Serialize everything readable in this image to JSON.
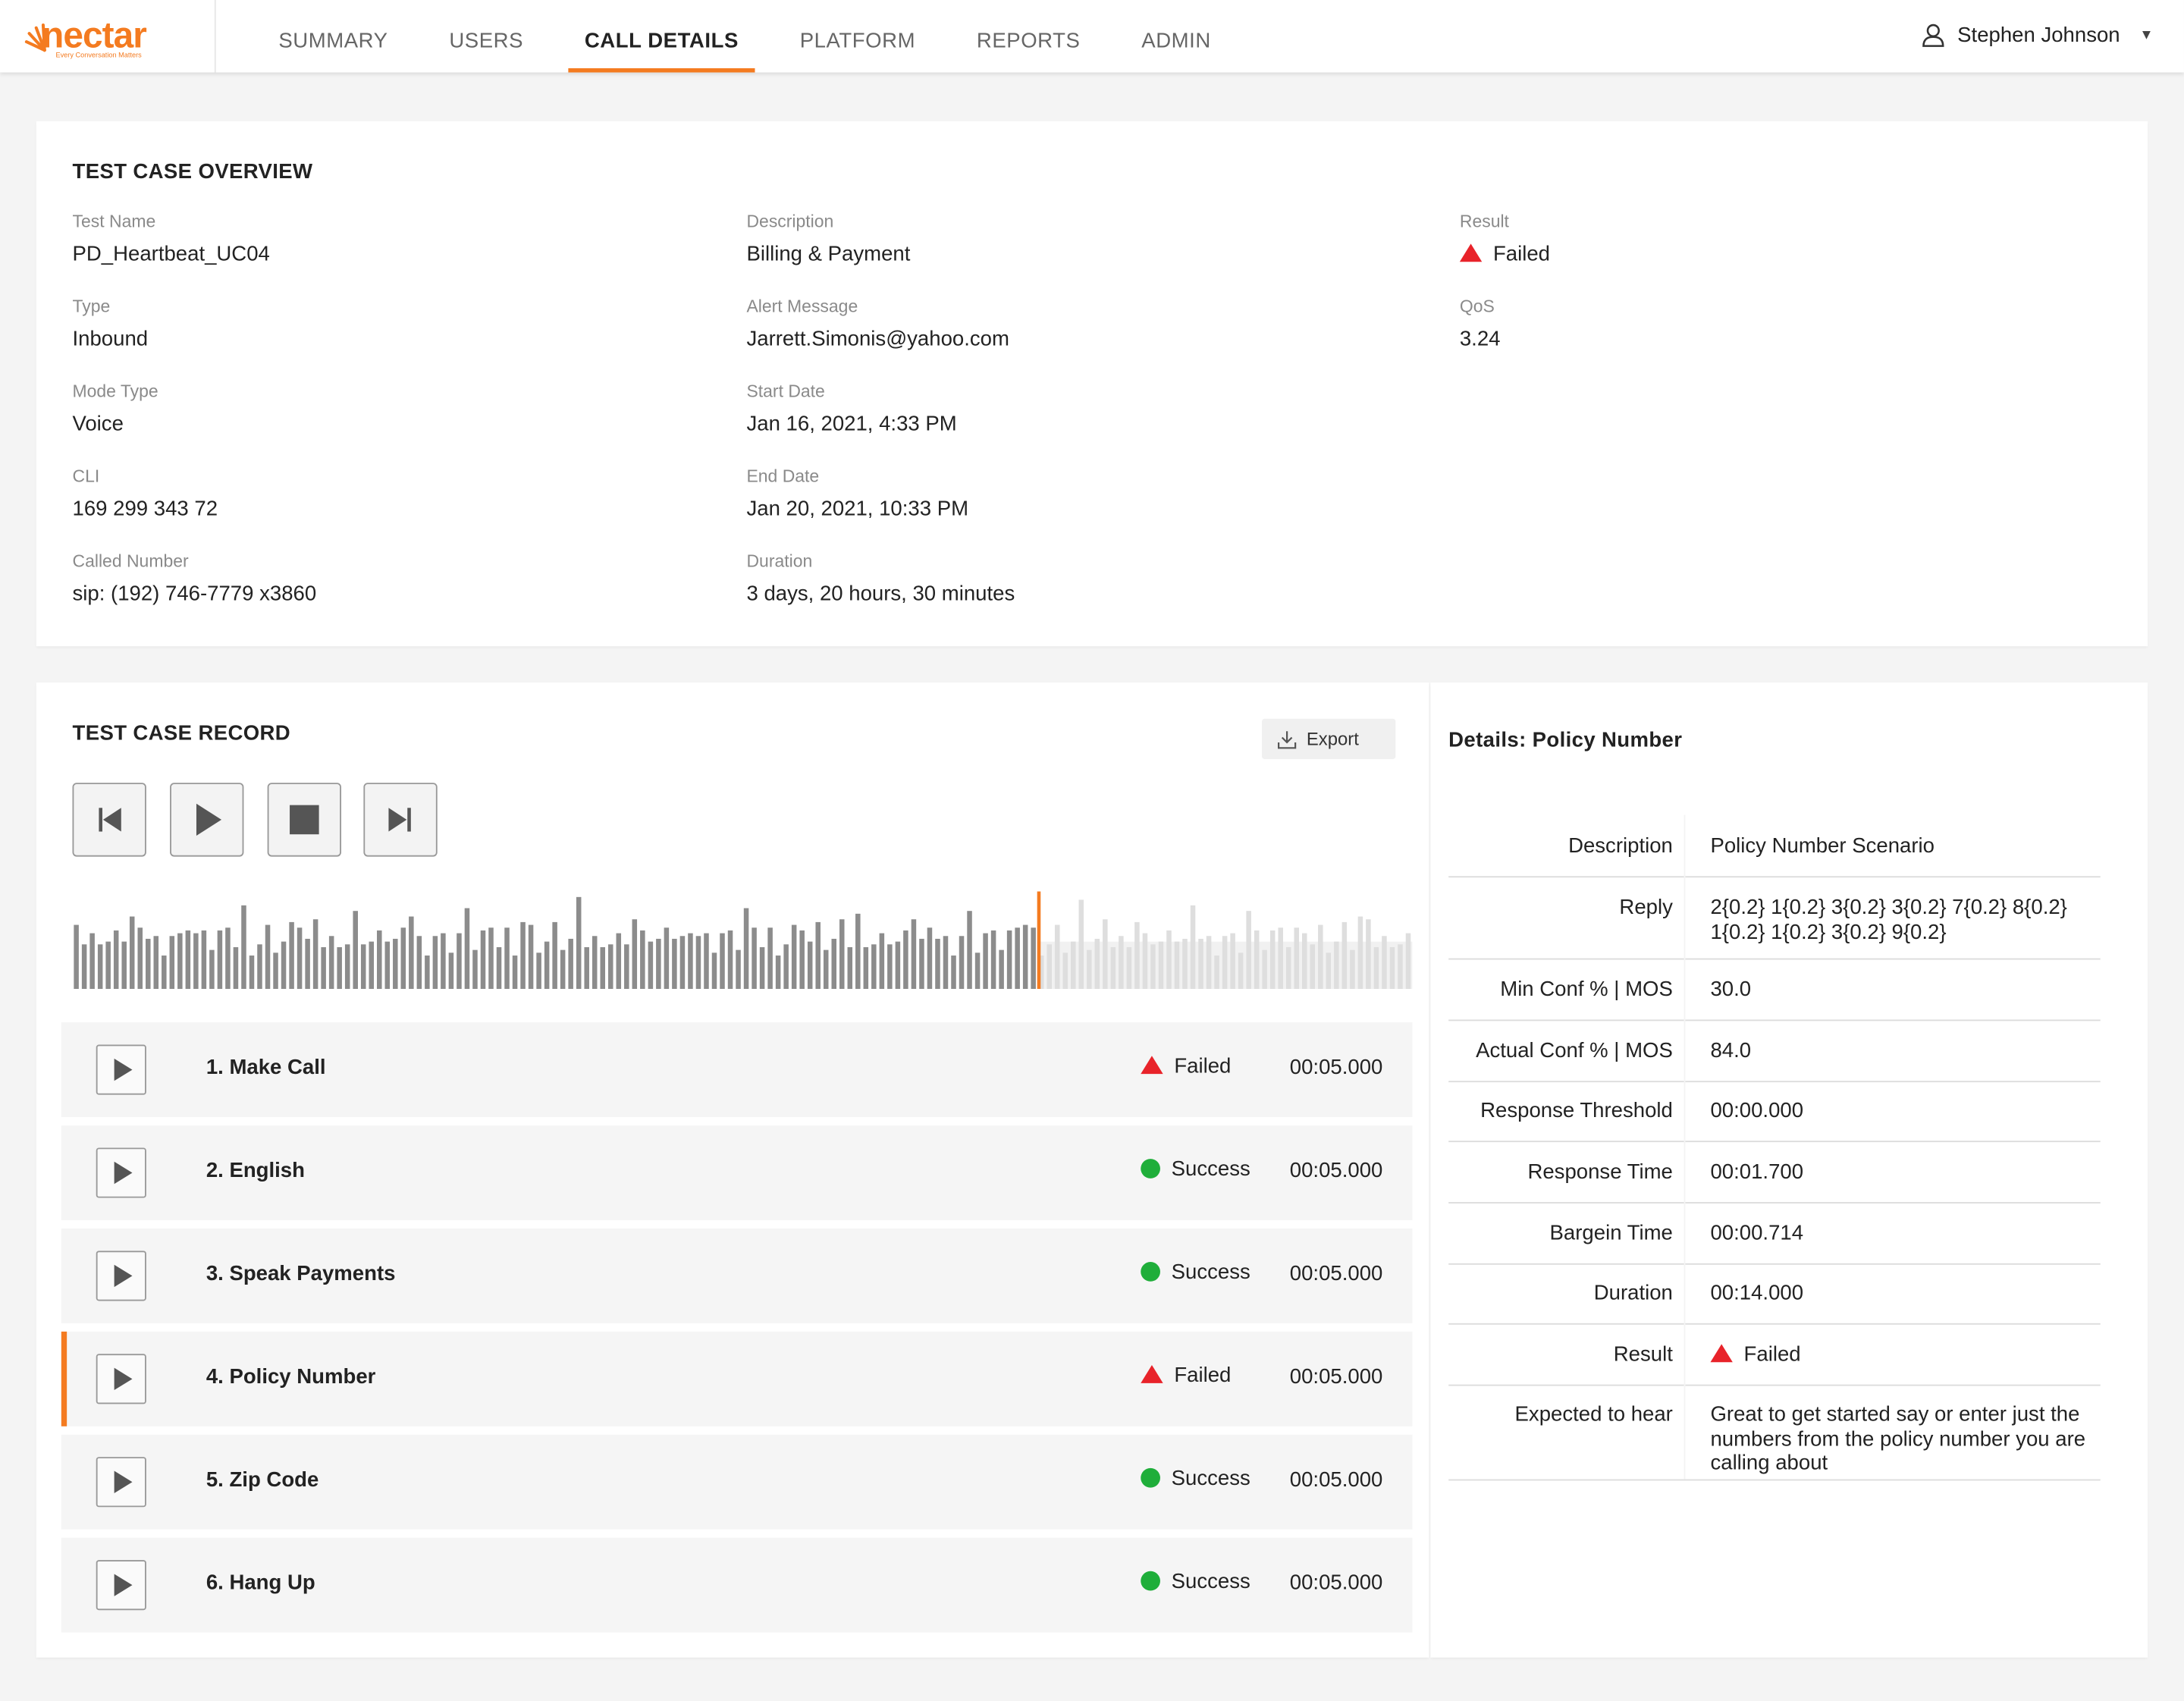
{
  "brand": {
    "name": "nectar",
    "tagline": "Every Conversation Matters",
    "color": "#f47b20"
  },
  "nav": {
    "tabs": [
      {
        "label": "SUMMARY"
      },
      {
        "label": "USERS"
      },
      {
        "label": "CALL DETAILS",
        "active": true
      },
      {
        "label": "PLATFORM"
      },
      {
        "label": "REPORTS"
      },
      {
        "label": "ADMIN"
      }
    ],
    "user": {
      "name": "Stephen Johnson",
      "icon": "user-icon"
    }
  },
  "overview": {
    "title": "TEST CASE OVERVIEW",
    "fields": {
      "test_name": {
        "label": "Test Name",
        "value": "PD_Heartbeat_UC04"
      },
      "type": {
        "label": "Type",
        "value": "Inbound"
      },
      "mode_type": {
        "label": "Mode Type",
        "value": "Voice"
      },
      "cli": {
        "label": "CLI",
        "value": "169 299 343 72"
      },
      "called_number": {
        "label": "Called Number",
        "value": "sip: (192) 746-7779 x3860"
      },
      "description": {
        "label": "Description",
        "value": "Billing & Payment"
      },
      "alert_message": {
        "label": "Alert Message",
        "value": "Jarrett.Simonis@yahoo.com"
      },
      "start_date": {
        "label": "Start Date",
        "value": "Jan 16, 2021, 4:33 PM"
      },
      "end_date": {
        "label": "End Date",
        "value": "Jan 20, 2021, 10:33 PM"
      },
      "duration": {
        "label": "Duration",
        "value": "3 days, 20 hours, 30 minutes"
      },
      "result": {
        "label": "Result",
        "value": "Failed"
      },
      "qos": {
        "label": "QoS",
        "value": "3.24"
      }
    }
  },
  "record": {
    "title": "TEST CASE RECORD",
    "export_label": "Export",
    "controls": [
      "skip-back-icon",
      "play-icon",
      "stop-icon",
      "skip-forward-icon"
    ],
    "playback_progress": 0.72,
    "steps": [
      {
        "name": "1. Make Call",
        "status": "Failed",
        "time": "00:05.000"
      },
      {
        "name": "2. English",
        "status": "Success",
        "time": "00:05.000"
      },
      {
        "name": "3. Speak Payments",
        "status": "Success",
        "time": "00:05.000"
      },
      {
        "name": "4. Policy Number",
        "status": "Failed",
        "time": "00:05.000",
        "active": true
      },
      {
        "name": "5. Zip Code",
        "status": "Success",
        "time": "00:05.000"
      },
      {
        "name": "6. Hang Up",
        "status": "Success",
        "time": "00:05.000"
      }
    ]
  },
  "details": {
    "title": "Details: Policy Number",
    "rows": [
      {
        "key": "Description",
        "value": "Policy Number Scenario"
      },
      {
        "key": "Reply",
        "value": "2{0.2} 1{0.2} 3{0.2} 3{0.2} 7{0.2} 8{0.2} 1{0.2} 1{0.2} 3{0.2} 9{0.2}"
      },
      {
        "key": "Min Conf % | MOS",
        "value": "30.0"
      },
      {
        "key": "Actual Conf % | MOS",
        "value": "84.0"
      },
      {
        "key": "Response Threshold",
        "value": "00:00.000"
      },
      {
        "key": "Response Time",
        "value": "00:01.700"
      },
      {
        "key": "Bargein Time",
        "value": "00:00.714"
      },
      {
        "key": "Duration",
        "value": "00:14.000"
      },
      {
        "key": "Result",
        "value": "Failed"
      },
      {
        "key": "Expected to hear",
        "value": "Great to get started say or enter just the numbers from the policy number you are calling about"
      }
    ]
  },
  "colors": {
    "failed": "#e8232a",
    "success": "#1fae3a",
    "accent": "#f47b20"
  }
}
